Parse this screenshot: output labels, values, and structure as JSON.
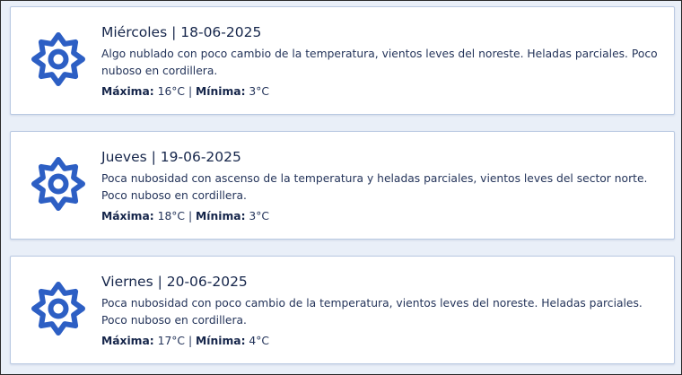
{
  "forecast": [
    {
      "day": "Miércoles",
      "date": "18-06-2025",
      "title": "Miércoles | 18-06-2025",
      "description": "Algo nublado con poco cambio de la temperatura, vientos leves del noreste. Heladas parciales. Poco nuboso en cordillera.",
      "max_label": "Máxima:",
      "max_value": "16°C",
      "separator": "|",
      "min_label": "Mínima:",
      "min_value": "3°C",
      "icon": "sun-icon"
    },
    {
      "day": "Jueves",
      "date": "19-06-2025",
      "title": "Jueves | 19-06-2025",
      "description": "Poca nubosidad con ascenso de la temperatura y heladas parciales, vientos leves del sector norte. Poco nuboso en cordillera.",
      "max_label": "Máxima:",
      "max_value": "18°C",
      "separator": "|",
      "min_label": "Mínima:",
      "min_value": "3°C",
      "icon": "sun-icon"
    },
    {
      "day": "Viernes",
      "date": "20-06-2025",
      "title": "Viernes | 20-06-2025",
      "description": "Poca nubosidad con poco cambio de la temperatura, vientos leves del noreste. Heladas parciales. Poco nuboso en cordillera.",
      "max_label": "Máxima:",
      "max_value": "17°C",
      "separator": "|",
      "min_label": "Mínima:",
      "min_value": "4°C",
      "icon": "sun-icon"
    }
  ],
  "colors": {
    "icon": "#2d5fc4",
    "card_border": "#b9c9e2",
    "page_background": "#e9eff8",
    "text": "#15254a"
  }
}
